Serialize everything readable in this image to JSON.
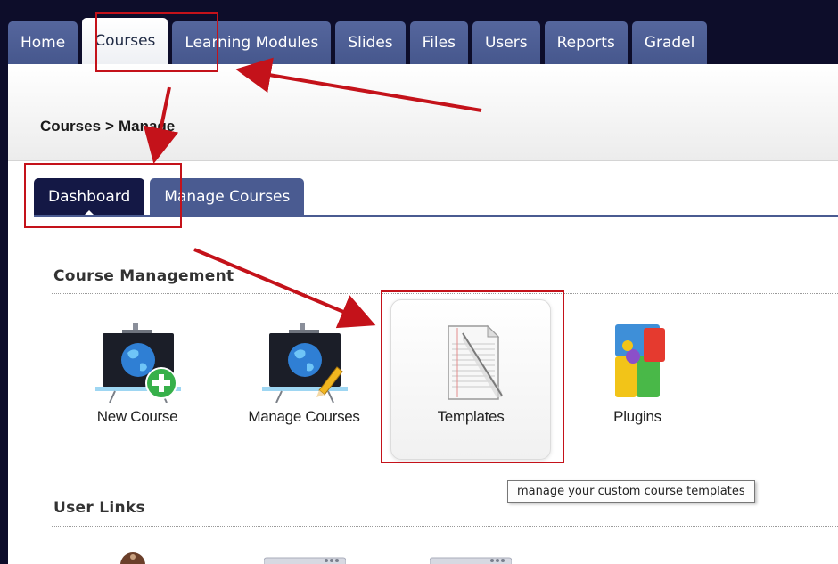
{
  "nav": {
    "tabs": [
      {
        "label": "Home"
      },
      {
        "label": "Courses",
        "active": true
      },
      {
        "label": "Learning Modules"
      },
      {
        "label": "Slides"
      },
      {
        "label": "Files"
      },
      {
        "label": "Users"
      },
      {
        "label": "Reports"
      },
      {
        "label": "Gradel"
      }
    ]
  },
  "breadcrumb": {
    "parent": "Courses",
    "separator": ">",
    "current": "Manage"
  },
  "subtabs": [
    {
      "label": "Dashboard",
      "active": true
    },
    {
      "label": "Manage Courses"
    }
  ],
  "course_management": {
    "title": "Course Management",
    "tiles": [
      {
        "label": "New Course",
        "icon": "new-course-icon"
      },
      {
        "label": "Manage Courses",
        "icon": "manage-courses-icon"
      },
      {
        "label": "Templates",
        "icon": "templates-icon"
      },
      {
        "label": "Plugins",
        "icon": "plugins-icon"
      }
    ]
  },
  "tooltip": "manage your custom course templates",
  "user_links": {
    "title": "User Links"
  },
  "colors": {
    "nav": "#46578d",
    "dark": "#0d0d2a",
    "annotation": "#c4121a"
  }
}
